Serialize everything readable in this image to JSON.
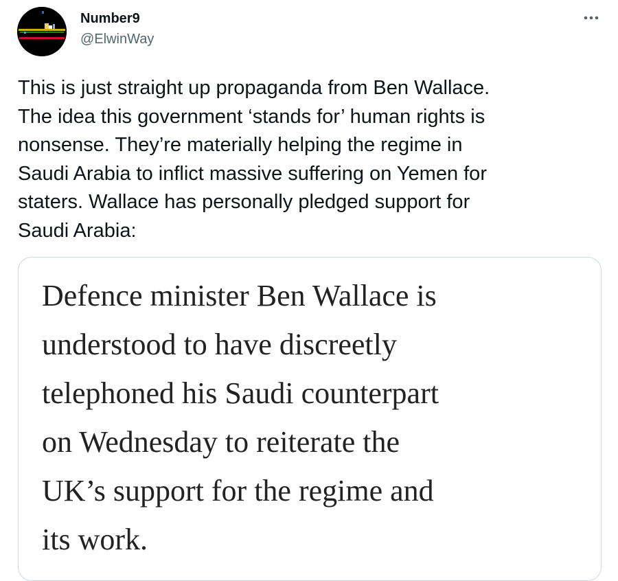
{
  "author": {
    "display_name": "Number9",
    "handle": "@ElwinWay",
    "avatar_icon": "pixel-art-avatar-icon"
  },
  "more_icon": "more-horizontal-icon",
  "tweet": {
    "text": "This is just straight up propaganda from Ben Wallace.\nThe idea this government ‘stands for’ human rights is\nnonsense. They’re materially helping the regime in\nSaudi Arabia to inflict massive suffering on Yemen for\nstaters. Wallace has personally pledged support for\nSaudi Arabia:"
  },
  "media": {
    "quote_text": "Defence minister Ben Wallace is\nunderstood to have discreetly\ntelephoned his Saudi counterpart\non Wednesday to reiterate the\nUK’s support for the regime and\nits work."
  },
  "colors": {
    "primary_text": "#0f1419",
    "secondary_text": "#536471",
    "card_border": "#cfd9de"
  }
}
